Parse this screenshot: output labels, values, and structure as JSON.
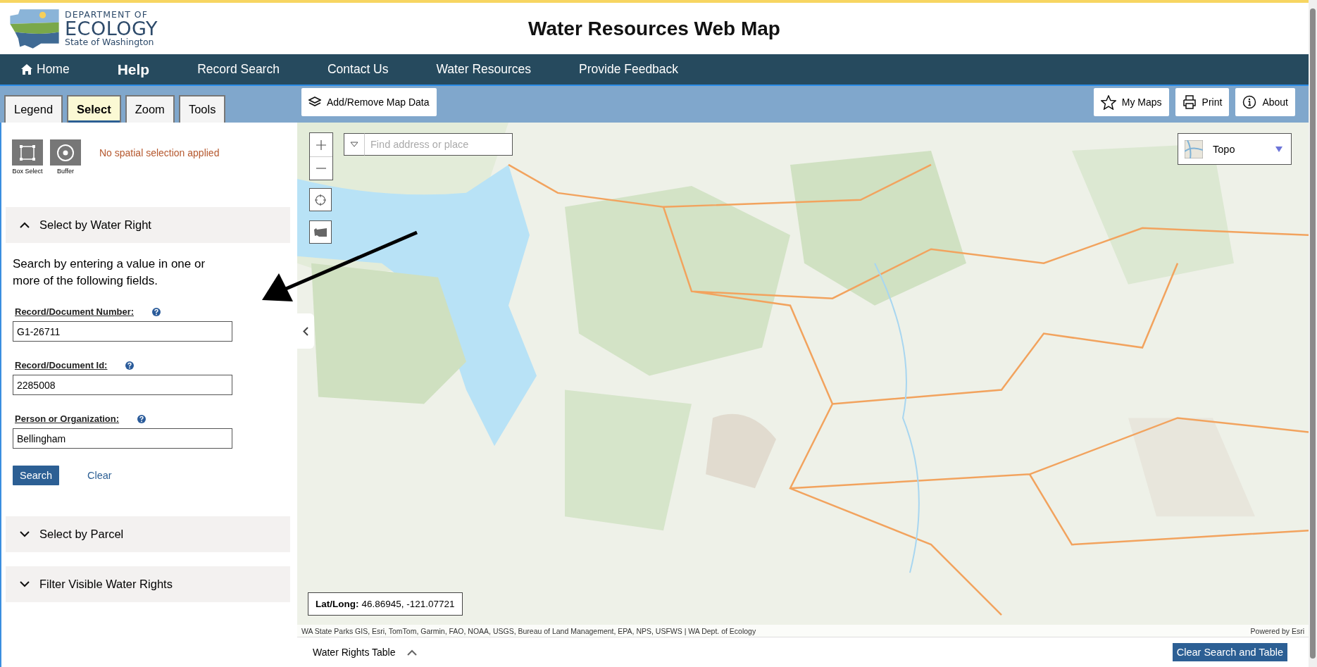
{
  "header": {
    "logo": {
      "line_1": "DEPARTMENT OF",
      "line_2": "ECOLOGY",
      "line_3": "State of Washington"
    },
    "title": "Water Resources Web Map"
  },
  "nav": [
    {
      "label": "Home",
      "kind": "home"
    },
    {
      "label": "Help",
      "kind": "bold"
    },
    {
      "label": "Record Search",
      "kind": "plain"
    },
    {
      "label": "Contact Us",
      "kind": "plain"
    },
    {
      "label": "Water Resources",
      "kind": "plain"
    },
    {
      "label": "Provide Feedback",
      "kind": "plain"
    }
  ],
  "panel_tabs": [
    {
      "label": "Legend",
      "selected": false
    },
    {
      "label": "Select",
      "selected": true
    },
    {
      "label": "Zoom",
      "selected": false
    },
    {
      "label": "Tools",
      "selected": false
    }
  ],
  "toolbar": {
    "add_data": "Add/Remove Map Data",
    "buttons": [
      {
        "label": "My Maps",
        "kind": "star"
      },
      {
        "label": "Print",
        "kind": "print"
      },
      {
        "label": "About",
        "kind": "info"
      }
    ]
  },
  "spatial_tools": [
    {
      "label": "Box Select",
      "kind": "box"
    },
    {
      "label": "Buffer",
      "kind": "buffer"
    }
  ],
  "spatial_status": "No spatial selection applied",
  "sections": [
    {
      "title": "Select by Water Right",
      "expanded": true,
      "intro": "Search by entering a value in one or more of the following fields.",
      "fields": [
        {
          "label": "Record/Document Number:",
          "value": "G1-26711"
        },
        {
          "label": "Record/Document Id:",
          "value": "2285008"
        },
        {
          "label": "Person or Organization:",
          "value": "Bellingham"
        }
      ],
      "search_button": "Search",
      "clear_link": "Clear"
    },
    {
      "title": "Select by Parcel",
      "expanded": false
    },
    {
      "title": "Filter Visible Water Rights",
      "expanded": false
    }
  ],
  "map": {
    "search_placeholder": "Find address or place",
    "basemap": "Topo",
    "coordinates": {
      "label": "Lat/Long:",
      "value": "46.86945, -121.07721"
    },
    "attribution": "WA State Parks GIS, Esri, TomTom, Garmin, FAO, NOAA, USGS, Bureau of Land Management, EPA, NPS, USFWS | WA Dept. of Ecology",
    "powered_by": "Powered by Esri"
  },
  "table_bar": {
    "title": "Water Rights Table",
    "expanded": false,
    "clear_button": "Clear Search and Table"
  }
}
